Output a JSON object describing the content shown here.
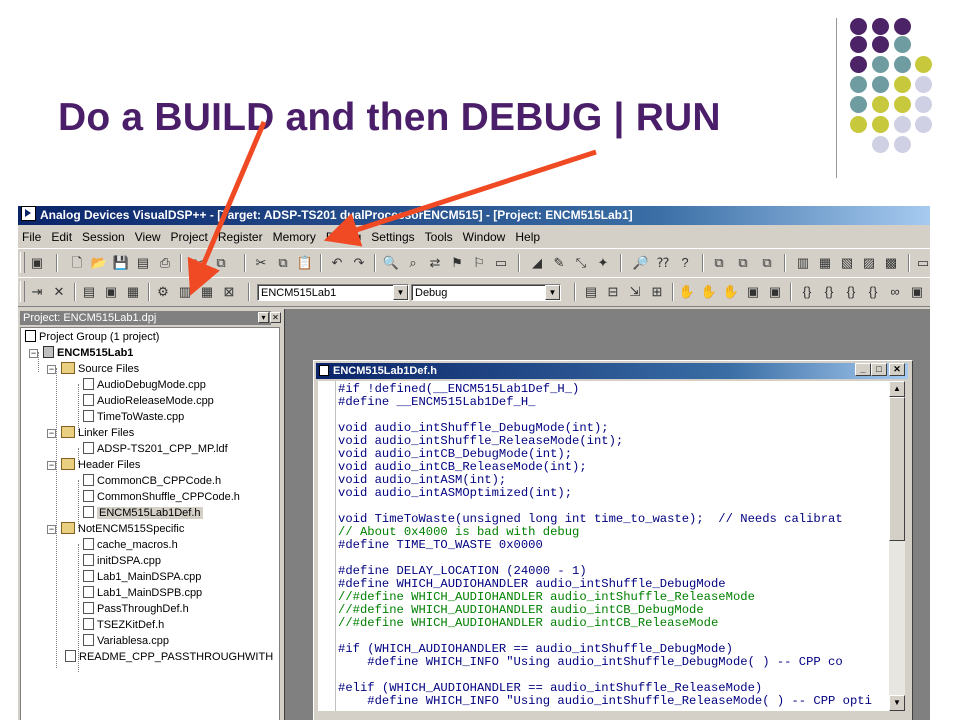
{
  "slide": {
    "title": "Do a BUILD and then DEBUG | RUN",
    "dot_colors": [
      "#4b2366",
      "#6f9ca0",
      "#c8c83c",
      "#d0d0e4"
    ]
  },
  "window": {
    "title": "Analog Devices VisualDSP++ - [Target: ADSP-TS201 dualProcessorENCM515] - [Project: ENCM515Lab1]"
  },
  "menu": [
    "File",
    "Edit",
    "Session",
    "View",
    "Project",
    "Register",
    "Memory",
    "Debug",
    "Settings",
    "Tools",
    "Window",
    "Help"
  ],
  "toolbar": {
    "project_combo": "ENCM515Lab1",
    "config_combo": "Debug",
    "icons_row1": [
      "build-target-icon",
      "new-file-icon",
      "open-icon",
      "save-icon",
      "save-all-icon",
      "print-icon",
      "cut-icon",
      "copy-icon",
      "paste-icon",
      "undo-icon",
      "redo-icon",
      "find-icon",
      "find-next-icon",
      "replace-icon",
      "bookmark-icon",
      "fill-icon",
      "erase-icon",
      "context-help-icon",
      "help-icon"
    ],
    "icons_row2": [
      "add-file-icon",
      "delete-icon",
      "project-options-icon",
      "compile-icon",
      "build-icon",
      "rebuild-all-icon",
      "halt-build-icon",
      "run-icon",
      "halt-icon",
      "step-into-icon",
      "step-over-icon",
      "step-out-icon"
    ]
  },
  "project_panel": {
    "header": "Project: ENCM515Lab1.dpj",
    "items": [
      "Project Group (1 project)",
      "ENCM515Lab1",
      "Source Files",
      "AudioDebugMode.cpp",
      "AudioReleaseMode.cpp",
      "TimeToWaste.cpp",
      "Linker Files",
      "ADSP-TS201_CPP_MP.ldf",
      "Header Files",
      "CommonCB_CPPCode.h",
      "CommonShuffle_CPPCode.h",
      "ENCM515Lab1Def.h",
      "NotENCM515Specific",
      "cache_macros.h",
      "initDSPA.cpp",
      "Lab1_MainDSPA.cpp",
      "Lab1_MainDSPB.cpp",
      "PassThroughDef.h",
      "TSEZKitDef.h",
      "Variablesa.cpp",
      "README_CPP_PASSTHROUGHWITH"
    ]
  },
  "editor": {
    "title": "ENCM515Lab1Def.h",
    "lines": [
      "#if !defined(__ENCM515Lab1Def_H_)",
      "#define __ENCM515Lab1Def_H_",
      "",
      "void audio_intShuffle_DebugMode(int);",
      "void audio_intShuffle_ReleaseMode(int);",
      "void audio_intCB_DebugMode(int);",
      "void audio_intCB_ReleaseMode(int);",
      "void audio_intASM(int);",
      "void audio_intASMOptimized(int);",
      "",
      "void TimeToWaste(unsigned long int time_to_waste);  // Needs calibrat",
      "// About 0x4000 is bad with debug",
      "#define TIME_TO_WASTE 0x0000",
      "",
      "#define DELAY_LOCATION (24000 - 1)",
      "#define WHICH_AUDIOHANDLER audio_intShuffle_DebugMode",
      "//#define WHICH_AUDIOHANDLER audio_intShuffle_ReleaseMode",
      "//#define WHICH_AUDIOHANDLER audio_intCB_DebugMode",
      "//#define WHICH_AUDIOHANDLER audio_intCB_ReleaseMode",
      "",
      "#if (WHICH_AUDIOHANDLER == audio_intShuffle_DebugMode)",
      "    #define WHICH_INFO \"Using audio_intShuffle_DebugMode( ) -- CPP co",
      "",
      "#elif (WHICH_AUDIOHANDLER == audio_intShuffle_ReleaseMode)",
      "    #define WHICH_INFO \"Using audio_intShuffle_ReleaseMode( ) -- CPP opti"
    ]
  },
  "annotation_colors": {
    "arrow": "#f04a24"
  }
}
